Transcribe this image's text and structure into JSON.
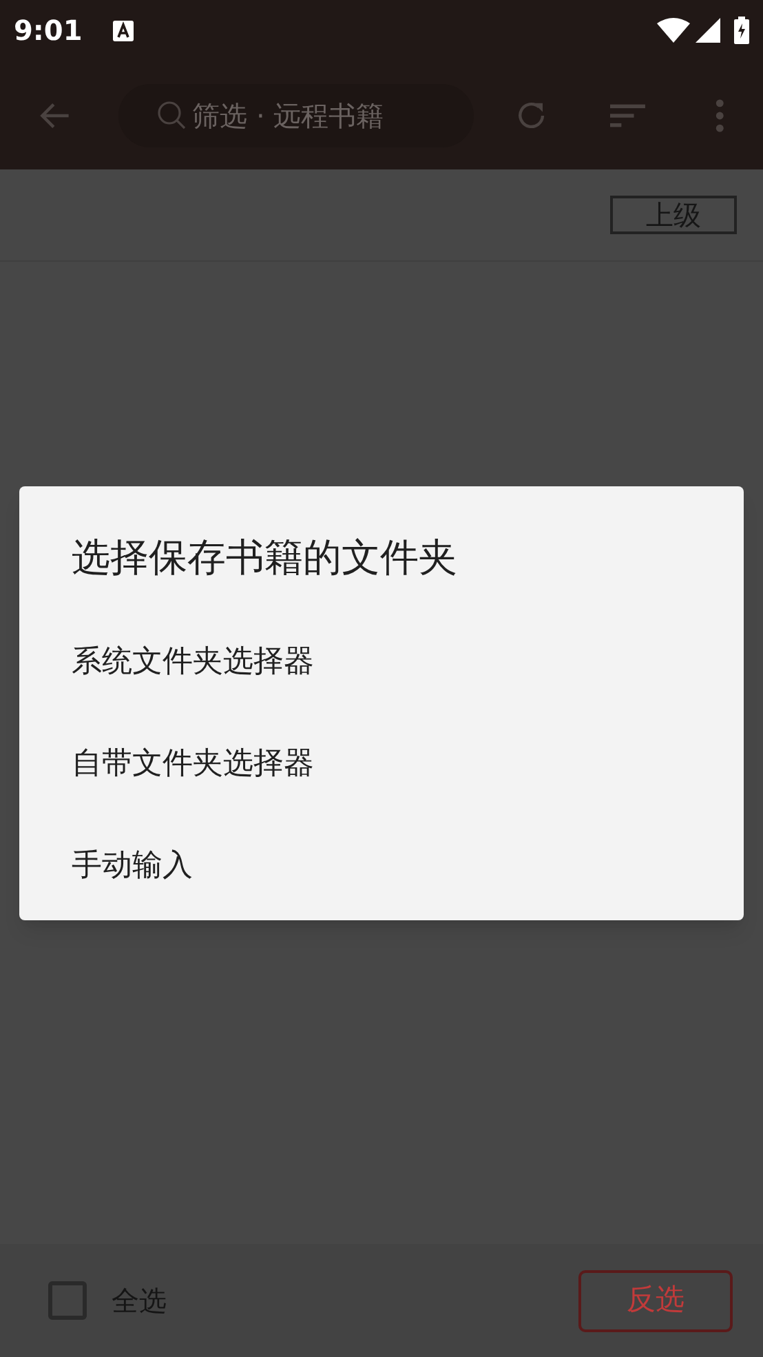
{
  "status_bar": {
    "time": "9:01"
  },
  "toolbar": {
    "search": {
      "placeholder": "筛选 · 远程书籍"
    }
  },
  "path_bar": {
    "up_button": "上级"
  },
  "dialog": {
    "title": "选择保存书籍的文件夹",
    "options": [
      "系统文件夹选择器",
      "自带文件夹选择器",
      "手动输入"
    ]
  },
  "bottom_bar": {
    "select_all": {
      "label": "全选",
      "checked": false
    },
    "invert_button": "反选"
  }
}
